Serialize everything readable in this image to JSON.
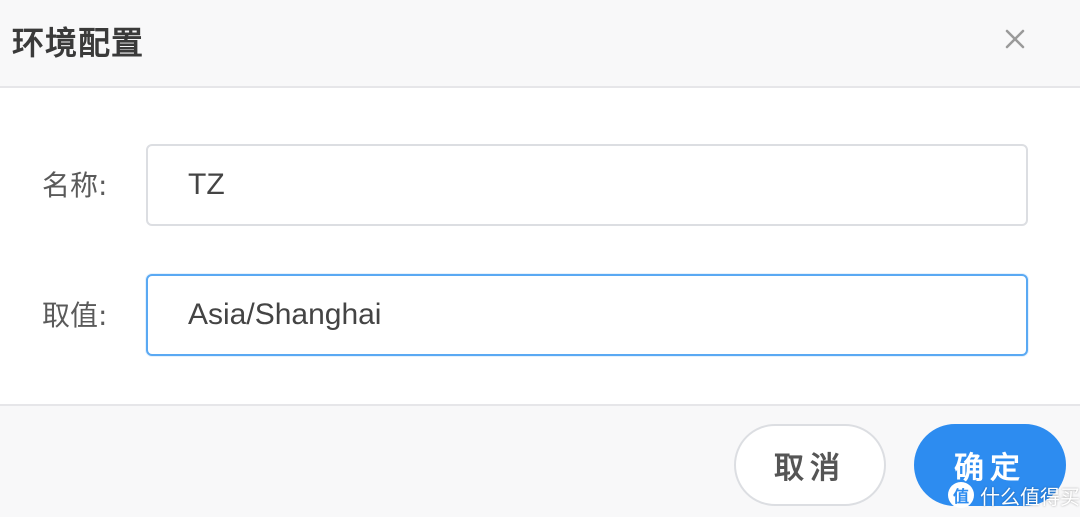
{
  "dialog": {
    "title": "环境配置",
    "close_icon": "close-icon"
  },
  "form": {
    "name_label": "名称:",
    "name_value": "TZ",
    "value_label": "取值:",
    "value_value": "Asia/Shanghai"
  },
  "footer": {
    "cancel_label": "取消",
    "ok_label": "确定"
  },
  "watermark": {
    "badge": "值",
    "text": "什么值得买"
  },
  "colors": {
    "primary": "#2d8cf0",
    "focus_border": "#5aa9f3",
    "border": "#dcdee2",
    "header_bg": "#f8f8f9"
  }
}
